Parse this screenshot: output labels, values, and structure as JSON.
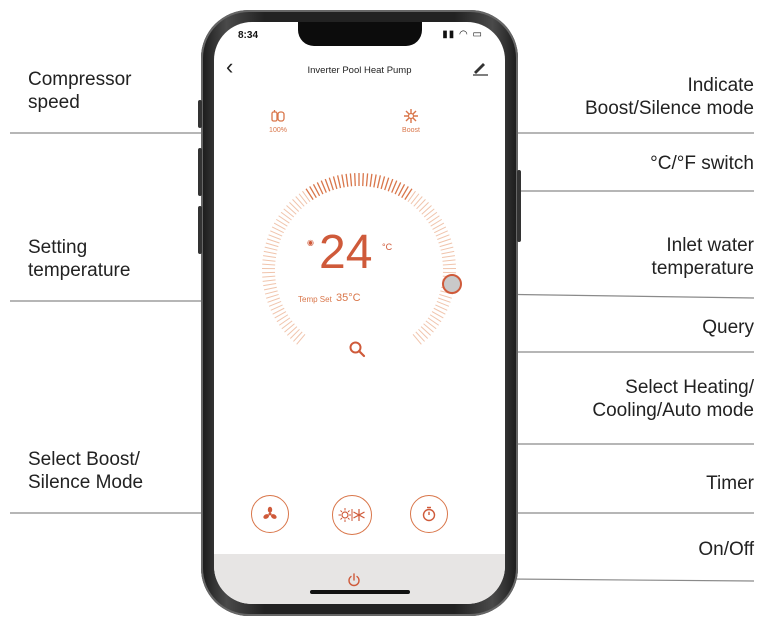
{
  "callouts": {
    "compressor_speed": "Compressor\nspeed",
    "setting_temperature": "Setting\ntemperature",
    "select_boost_silence": "Select Boost/\nSilence Mode",
    "indicate_mode": "Indicate\nBoost/Silence mode",
    "unit_switch": "°C/°F  switch",
    "inlet_water": "Inlet water\ntemperature",
    "query": "Query",
    "select_mode": "Select  Heating/\nCooling/Auto mode",
    "timer": "Timer",
    "on_off": "On/Off"
  },
  "phone": {
    "status_time": "8:34",
    "nav_title": "Inverter Pool Heat Pump",
    "compressor_value": "100%",
    "mode_value": "Boost",
    "set_temperature": "24",
    "unit": "°C",
    "temp_set_label": "Temp Set",
    "inlet_temperature": "35°C"
  },
  "colors": {
    "accent": "#d9764a",
    "accent_dark": "#cf5a3a",
    "bottom_bar": "#e7e5e4"
  },
  "icons": [
    "back-icon",
    "edit-icon",
    "compressor-icon",
    "boost-icon",
    "query-icon",
    "fan-icon",
    "heat-cool-icon",
    "timer-icon",
    "power-icon"
  ]
}
